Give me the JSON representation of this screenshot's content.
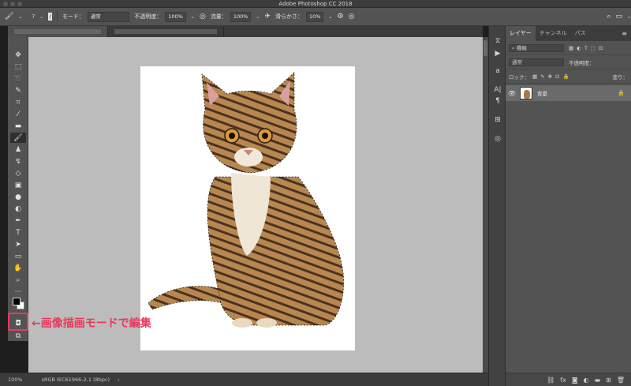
{
  "app": {
    "title": "Adobe Photoshop CC 2018"
  },
  "options": {
    "mode_label": "モード：",
    "mode_value": "通常",
    "opacity_label": "不透明度：",
    "opacity_value": "100%",
    "flow_label": "流量：",
    "flow_value": "100%",
    "smoothing_label": "滑らかさ：",
    "smoothing_value": "10%",
    "brush_size": "7"
  },
  "layers_panel": {
    "tabs": [
      "レイヤー",
      "チャンネル",
      "パス"
    ],
    "filter_placeholder": "種類",
    "blend_mode": "通常",
    "opacity_label": "不透明度：",
    "lock_label": "ロック：",
    "fill_label": "塗り：",
    "layer_name": "背景"
  },
  "callout": "←画像描画モードで編集",
  "status": {
    "zoom": "100%",
    "profile": "sRGB IEC61966-2.1 (8bpc)"
  },
  "colors": {
    "highlight": "#e8395c",
    "foreground": "#000000",
    "background": "#ffffff"
  }
}
